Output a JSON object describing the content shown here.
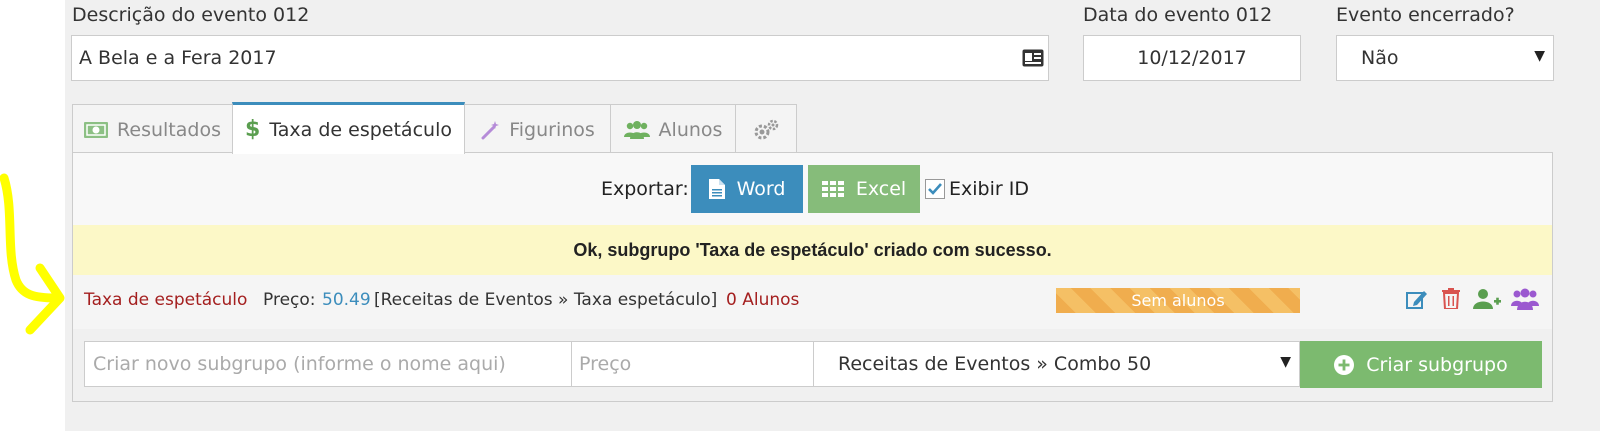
{
  "header": {
    "desc_label": "Descrição do evento 012",
    "desc_value": "A Bela e a Fera 2017",
    "date_label": "Data do evento 012",
    "date_value": "10/12/2017",
    "closed_label": "Evento encerrado?",
    "closed_value": "Não"
  },
  "tabs": [
    {
      "label": "Resultados",
      "icon": "money-icon"
    },
    {
      "label": "Taxa de espetáculo",
      "icon": "dollar-icon"
    },
    {
      "label": "Figurinos",
      "icon": "magic-wand-icon"
    },
    {
      "label": "Alunos",
      "icon": "users-icon"
    },
    {
      "label": "",
      "icon": "gears-icon"
    }
  ],
  "export": {
    "label": "Exportar:",
    "word_label": "Word",
    "excel_label": "Excel",
    "show_id_label": "Exibir ID",
    "show_id_checked": true
  },
  "alert": {
    "message": "Ok, subgrupo 'Taxa de espetáculo' criado com sucesso."
  },
  "subgroup": {
    "name": "Taxa de espetáculo",
    "price_label": "Preço:",
    "price_value": "50.49",
    "category": "[Receitas de Eventos » Taxa espetáculo]",
    "students": "0 Alunos",
    "status_badge": "Sem alunos"
  },
  "new_subgroup": {
    "name_placeholder": "Criar novo subgrupo (informe o nome aqui)",
    "price_placeholder": "Preço",
    "category_value": "Receitas de Eventos » Combo 50",
    "create_label": "Criar subgrupo"
  },
  "colors": {
    "tab_active_border": "#3c8dbc",
    "word_button": "#3c8dbc",
    "excel_button": "#86bc7a",
    "alert_bg": "#fcf8c7",
    "subgroup_name": "#a41f1f",
    "price_value": "#3c8dbc",
    "badge": "#f0ad4e",
    "create_button": "#7cba6f",
    "arrow": "#ffff00"
  }
}
